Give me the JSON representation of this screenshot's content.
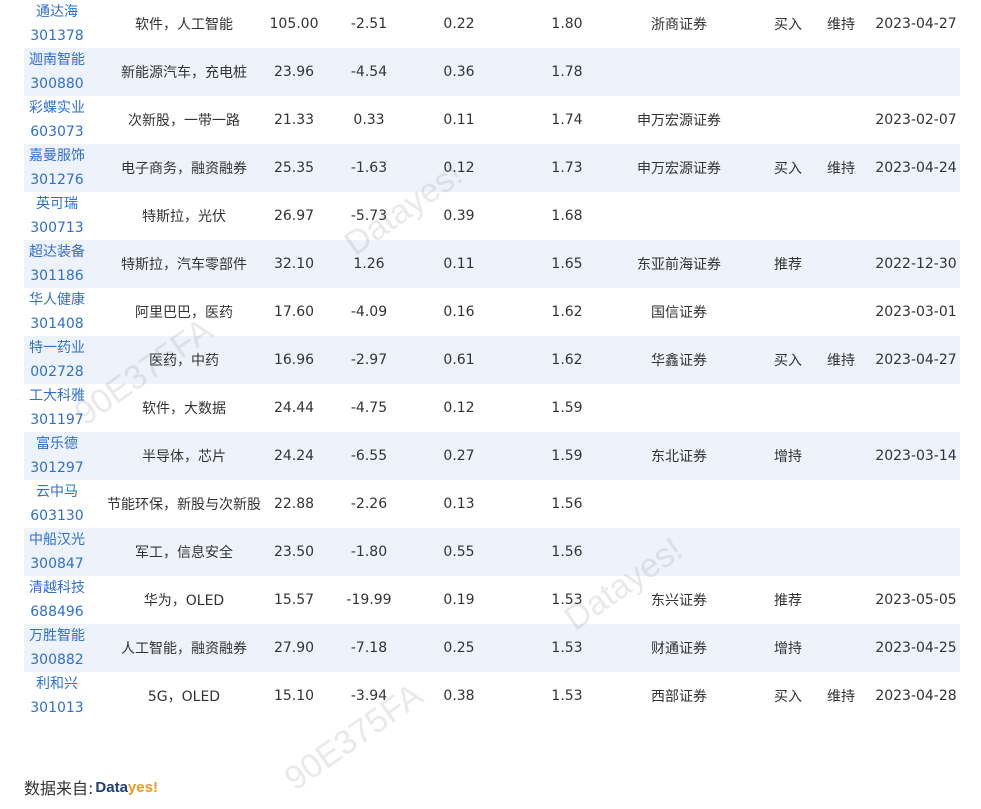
{
  "rows": [
    {
      "name": "通达海",
      "code": "301378",
      "concept": "软件，人工智能",
      "price": "105.00",
      "change_pct": "-2.51",
      "v1": "0.22",
      "v2": "1.80",
      "broker": "浙商证券",
      "rating": "买入",
      "rating_change": "维持",
      "date": "2023-04-27"
    },
    {
      "name": "迦南智能",
      "code": "300880",
      "concept": "新能源汽车，充电桩",
      "price": "23.96",
      "change_pct": "-4.54",
      "v1": "0.36",
      "v2": "1.78",
      "broker": "",
      "rating": "",
      "rating_change": "",
      "date": ""
    },
    {
      "name": "彩蝶实业",
      "code": "603073",
      "concept": "次新股，一带一路",
      "price": "21.33",
      "change_pct": "0.33",
      "v1": "0.11",
      "v2": "1.74",
      "broker": "申万宏源证券",
      "rating": "",
      "rating_change": "",
      "date": "2023-02-07"
    },
    {
      "name": "嘉曼服饰",
      "code": "301276",
      "concept": "电子商务，融资融券",
      "price": "25.35",
      "change_pct": "-1.63",
      "v1": "0.12",
      "v2": "1.73",
      "broker": "申万宏源证券",
      "rating": "买入",
      "rating_change": "维持",
      "date": "2023-04-24"
    },
    {
      "name": "英可瑞",
      "code": "300713",
      "concept": "特斯拉，光伏",
      "price": "26.97",
      "change_pct": "-5.73",
      "v1": "0.39",
      "v2": "1.68",
      "broker": "",
      "rating": "",
      "rating_change": "",
      "date": ""
    },
    {
      "name": "超达装备",
      "code": "301186",
      "concept": "特斯拉，汽车零部件",
      "price": "32.10",
      "change_pct": "1.26",
      "v1": "0.11",
      "v2": "1.65",
      "broker": "东亚前海证券",
      "rating": "推荐",
      "rating_change": "",
      "date": "2022-12-30"
    },
    {
      "name": "华人健康",
      "code": "301408",
      "concept": "阿里巴巴，医药",
      "price": "17.60",
      "change_pct": "-4.09",
      "v1": "0.16",
      "v2": "1.62",
      "broker": "国信证券",
      "rating": "",
      "rating_change": "",
      "date": "2023-03-01"
    },
    {
      "name": "特一药业",
      "code": "002728",
      "concept": "医药，中药",
      "price": "16.96",
      "change_pct": "-2.97",
      "v1": "0.61",
      "v2": "1.62",
      "broker": "华鑫证券",
      "rating": "买入",
      "rating_change": "维持",
      "date": "2023-04-27"
    },
    {
      "name": "工大科雅",
      "code": "301197",
      "concept": "软件，大数据",
      "price": "24.44",
      "change_pct": "-4.75",
      "v1": "0.12",
      "v2": "1.59",
      "broker": "",
      "rating": "",
      "rating_change": "",
      "date": ""
    },
    {
      "name": "富乐德",
      "code": "301297",
      "concept": "半导体，芯片",
      "price": "24.24",
      "change_pct": "-6.55",
      "v1": "0.27",
      "v2": "1.59",
      "broker": "东北证券",
      "rating": "增持",
      "rating_change": "",
      "date": "2023-03-14"
    },
    {
      "name": "云中马",
      "code": "603130",
      "concept": "节能环保，新股与次新股",
      "price": "22.88",
      "change_pct": "-2.26",
      "v1": "0.13",
      "v2": "1.56",
      "broker": "",
      "rating": "",
      "rating_change": "",
      "date": ""
    },
    {
      "name": "中船汉光",
      "code": "300847",
      "concept": "军工，信息安全",
      "price": "23.50",
      "change_pct": "-1.80",
      "v1": "0.55",
      "v2": "1.56",
      "broker": "",
      "rating": "",
      "rating_change": "",
      "date": ""
    },
    {
      "name": "清越科技",
      "code": "688496",
      "concept": "华为，OLED",
      "price": "15.57",
      "change_pct": "-19.99",
      "v1": "0.19",
      "v2": "1.53",
      "broker": "东兴证券",
      "rating": "推荐",
      "rating_change": "",
      "date": "2023-05-05"
    },
    {
      "name": "万胜智能",
      "code": "300882",
      "concept": "人工智能，融资融券",
      "price": "27.90",
      "change_pct": "-7.18",
      "v1": "0.25",
      "v2": "1.53",
      "broker": "财通证券",
      "rating": "增持",
      "rating_change": "",
      "date": "2023-04-25"
    },
    {
      "name": "利和兴",
      "code": "301013",
      "concept": "5G，OLED",
      "price": "15.10",
      "change_pct": "-3.94",
      "v1": "0.38",
      "v2": "1.53",
      "broker": "西部证券",
      "rating": "买入",
      "rating_change": "维持",
      "date": "2023-04-28"
    }
  ],
  "footer": {
    "source_label": "数据来自:",
    "logo_part1": "Data",
    "logo_part2": "yes!"
  },
  "watermark": {
    "brand": "Datayes!",
    "code": "90E375FA"
  },
  "colors": {
    "link": "#2e6fd6",
    "row_stripe": "#eef3fb",
    "logo_dark": "#1f3d7a",
    "logo_orange": "#f29a1f"
  }
}
